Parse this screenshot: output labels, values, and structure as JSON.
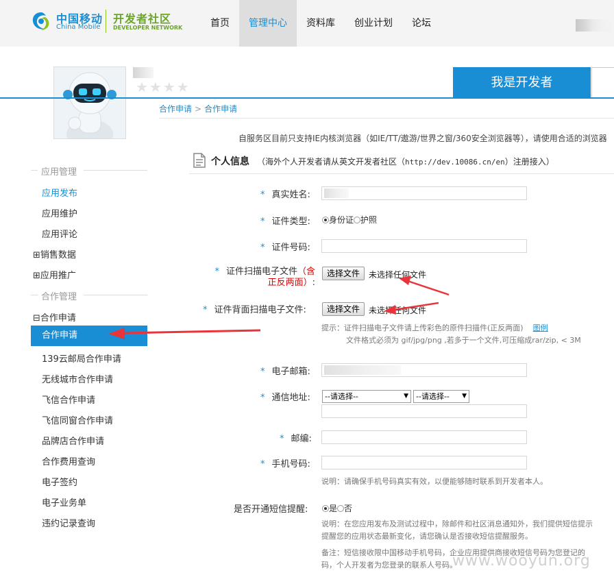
{
  "header": {
    "logo_cn": "中国移动",
    "logo_en": "China Mobile",
    "dev_cn": "开发者社区",
    "dev_en": "DEVELOPER NETWORK",
    "nav": [
      "首页",
      "管理中心",
      "资料库",
      "创业计划",
      "论坛"
    ],
    "active_nav": "管理中心"
  },
  "profile": {
    "i_am_dev": "我是开发者",
    "stars": "★★★★"
  },
  "breadcrumb": [
    "合作申请",
    "合作申请"
  ],
  "notice": "自服务区目前只支持IE内核浏览器（如IE/TT/遨游/世界之窗/360安全浏览器等），请使用合适的浏览器",
  "sidebar": {
    "app_mgmt": "应用管理",
    "app_items": [
      "应用发布",
      "应用维护",
      "应用评论"
    ],
    "groups": [
      "⊞销售数据",
      "⊞应用推广"
    ],
    "coop_mgmt": "合作管理",
    "coop_group": "⊟合作申请",
    "active_item": "合作申请",
    "coop_items": [
      "139云邮局合作申请",
      "无线城市合作申请",
      "飞信合作申请",
      "飞信同窗合作申请",
      "品牌店合作申请",
      "合作费用查询",
      "电子签约",
      "电子业务单",
      "违约记录查询"
    ]
  },
  "form": {
    "section_title": "个人信息",
    "section_note_a": "（海外个人开发者请从英文开发者社区（",
    "section_note_url": "http://dev.10086.cn/en",
    "section_note_b": "）注册接入）",
    "real_name": "真实姓名:",
    "id_type": "证件类型:",
    "id_opt1": "身份证",
    "id_opt2": "护照",
    "id_number": "证件号码:",
    "scan_front": "证件扫描电子文件",
    "scan_front_red1": "（含",
    "scan_front_red2": "正反两面）",
    "scan_front_colon": ":",
    "scan_back": "证件背面扫描电子文件:",
    "file_btn": "选择文件",
    "file_none": "未选择任何文件",
    "hint1": "提示：证件扫描电子文件请上传彩色的原件扫描件(正反两面)",
    "hint1_link": "图例",
    "hint2": "文件格式必须为 gif/jpg/png ,若多于一个文件,可压缩成rar/zip, < 3M",
    "email": "电子邮箱:",
    "address": "通信地址:",
    "select_placeholder1": "--请选择--",
    "select_placeholder2": "--请选择--",
    "zip": "邮编:",
    "phone": "手机号码:",
    "phone_hint": "说明：请确保手机号码真实有效，以便能够随时联系到开发者本人。",
    "sms": "是否开通短信提醒:",
    "sms_yes": "是",
    "sms_no": "否",
    "sms_hint1": "说明：在您应用发布及测试过程中，除邮件和社区消息通知外，我们提供短信提示",
    "sms_hint2": "提醒您的应用状态最新变化，请您确认是否接收短信提醒服务。",
    "sms_hint3": "备注：短信接收限中国移动手机号码，企业应用提供商接收短信号码为您登记的",
    "sms_hint4": "码，个人开发者为您登录的联系人号码。"
  },
  "watermark": "www.wooyun.org",
  "colors": {
    "accent": "#1a8ed4",
    "green": "#6aa52a",
    "red_arrow": "#e8343a"
  }
}
